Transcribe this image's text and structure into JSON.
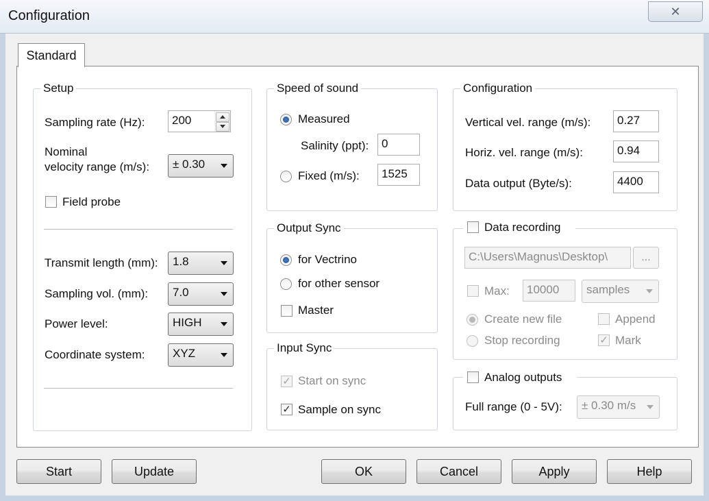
{
  "window": {
    "title": "Configuration",
    "close_symbol": "✕"
  },
  "tabs": [
    {
      "label": "Standard",
      "selected": true
    }
  ],
  "setup": {
    "title": "Setup",
    "sampling_rate_label": "Sampling rate (Hz):",
    "sampling_rate_value": "200",
    "nominal_velocity_label_line1": "Nominal",
    "nominal_velocity_label_line2": "velocity range (m/s):",
    "nominal_velocity_value": "± 0.30",
    "field_probe_label": "Field probe",
    "field_probe_checked": false,
    "transmit_length_label": "Transmit length (mm):",
    "transmit_length_value": "1.8",
    "sampling_vol_label": "Sampling vol. (mm):",
    "sampling_vol_value": "7.0",
    "power_level_label": "Power level:",
    "power_level_value": "HIGH",
    "coordinate_system_label": "Coordinate system:",
    "coordinate_system_value": "XYZ"
  },
  "speed_of_sound": {
    "title": "Speed of sound",
    "measured_label": "Measured",
    "salinity_label": "Salinity (ppt):",
    "salinity_value": "0",
    "fixed_label": "Fixed (m/s):",
    "fixed_value": "1525",
    "selected": "Measured"
  },
  "output_sync": {
    "title": "Output Sync",
    "for_vectrino_label": "for Vectrino",
    "for_other_sensor_label": "for other sensor",
    "master_label": "Master",
    "selected": "for Vectrino",
    "master_checked": false
  },
  "input_sync": {
    "title": "Input Sync",
    "start_on_sync_label": "Start on sync",
    "start_on_sync_checked": true,
    "sample_on_sync_label": "Sample on sync",
    "sample_on_sync_checked": true
  },
  "configuration": {
    "title": "Configuration",
    "vertical_range_label": "Vertical vel. range (m/s):",
    "vertical_range_value": "0.27",
    "horiz_range_label": "Horiz. vel. range (m/s):",
    "horiz_range_value": "0.94",
    "data_output_label": "Data output (Byte/s):",
    "data_output_value": "4400"
  },
  "data_recording": {
    "title": "Data recording",
    "enabled": false,
    "path_value": "C:\\Users\\Magnus\\Desktop\\",
    "browse_label": "...",
    "max_label": "Max:",
    "max_checked": false,
    "max_value": "10000",
    "max_unit": "samples",
    "create_new_file_label": "Create new file",
    "stop_recording_label": "Stop recording",
    "append_label": "Append",
    "append_checked": false,
    "mark_label": "Mark",
    "mark_checked": true
  },
  "analog_outputs": {
    "title": "Analog outputs",
    "enabled": false,
    "full_range_label": "Full range (0 - 5V):",
    "full_range_value": "± 0.30 m/s"
  },
  "buttons": {
    "start": "Start",
    "update": "Update",
    "ok": "OK",
    "cancel": "Cancel",
    "apply": "Apply",
    "help": "Help"
  },
  "check_glyph": "✓"
}
